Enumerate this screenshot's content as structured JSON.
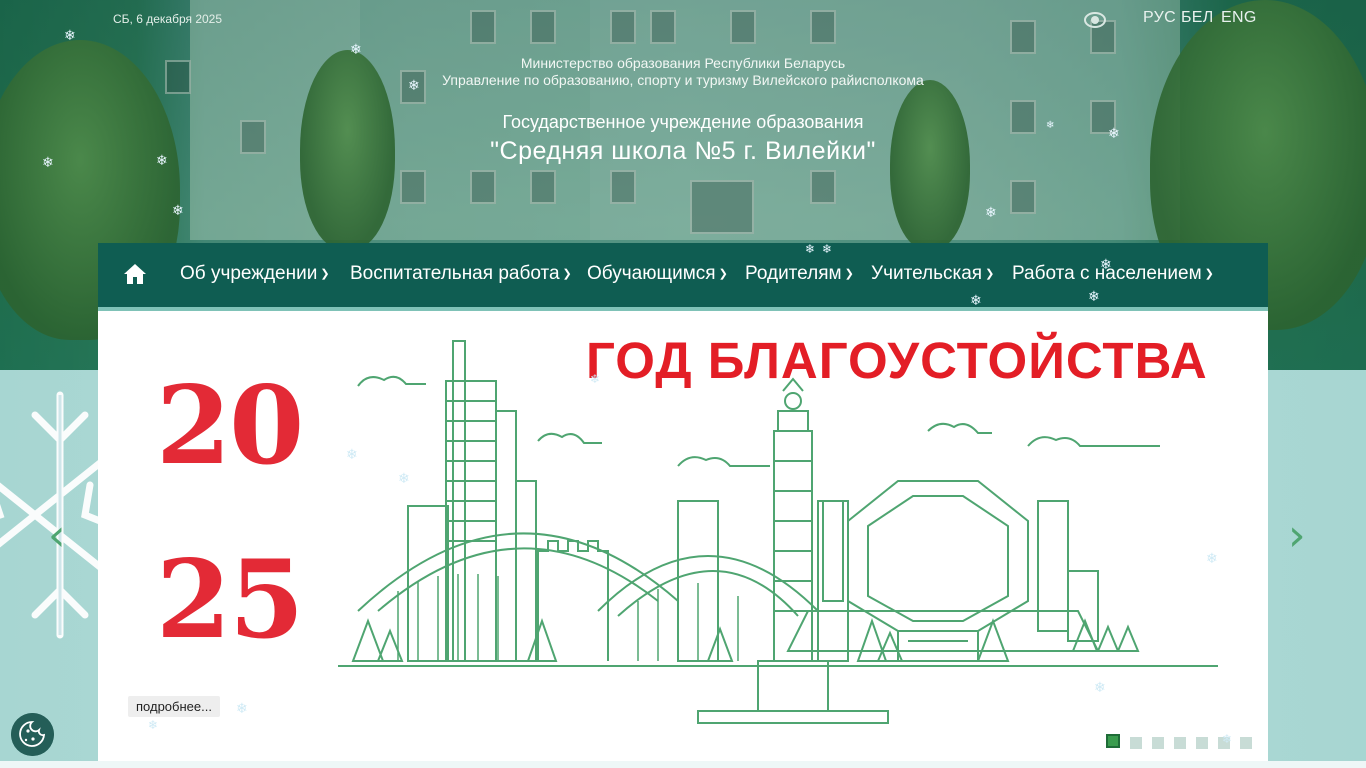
{
  "header": {
    "date": "СБ, 6 декабря 2025",
    "languages": [
      "РУС",
      "БЕЛ",
      "ENG"
    ],
    "ministry": "Министерство образования Республики Беларусь",
    "department": "Управление по образованию, спорту и туризму Вилейского райисполкома",
    "institution_type": "Государственное учреждение образования",
    "school_name": "\"Средняя школа №5 г. Вилейки\""
  },
  "nav": {
    "items": [
      {
        "label": "Об учреждении"
      },
      {
        "label": "Воспитательная работа"
      },
      {
        "label": "Обучающимся"
      },
      {
        "label": "Родителям"
      },
      {
        "label": "Учительская"
      },
      {
        "label": "Работа с населением"
      }
    ]
  },
  "slider": {
    "title": "ГОД БЛАГОУСТОЙСТВА",
    "year_top": "20",
    "year_bottom": "25",
    "more_label": "подробнее...",
    "active_slide": 1,
    "slide_count": 7
  },
  "colors": {
    "nav_bg": "#0f5d52",
    "title_red": "#e31e26",
    "illustration_green": "#4fa571",
    "active_dot": "#3a9c4e"
  },
  "icons": {
    "home": "home-icon",
    "eye": "eye-icon",
    "prev": "chevron-left-icon",
    "next": "chevron-right-icon",
    "cookie": "cookie-icon"
  }
}
